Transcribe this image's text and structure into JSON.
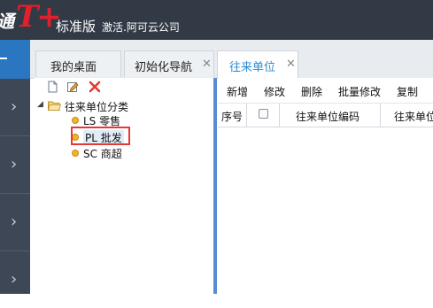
{
  "header": {
    "logo_prefix": "通",
    "logo_mark": "T+",
    "edition": "标准版",
    "company": "激活.阿可云公司",
    "accent_color": "#e1202b",
    "bar_color": "#323a46"
  },
  "leftnav": {
    "top_icon": "collapse-dash-icon",
    "items_icon": "chevron-right-icon"
  },
  "tabs": [
    {
      "label": "我的桌面"
    },
    {
      "label": "初始化导航",
      "close": "✕"
    },
    {
      "label": "往来单位",
      "close": "✕"
    }
  ],
  "tree_toolbar": {
    "icons": [
      "new-document-icon",
      "edit-icon",
      "delete-icon"
    ]
  },
  "tree": {
    "root_label": "往来单位分类",
    "children": [
      {
        "label": "LS 零售"
      },
      {
        "label": "PL 批发"
      },
      {
        "label": "SC 商超"
      }
    ]
  },
  "actions": [
    "新增",
    "修改",
    "删除",
    "批量修改",
    "复制"
  ],
  "grid": {
    "columns": [
      "序号",
      "",
      "往来单位编码",
      "往来单位"
    ]
  }
}
